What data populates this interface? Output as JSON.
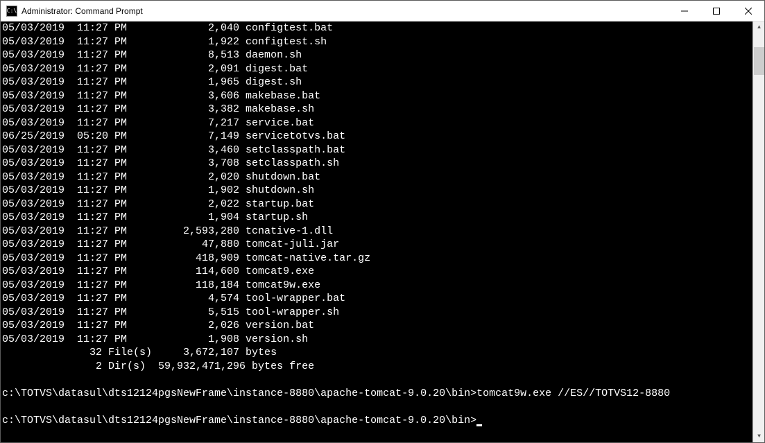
{
  "window": {
    "title": "Administrator: Command Prompt",
    "iconText": "C:\\"
  },
  "files": [
    {
      "date": "05/03/2019",
      "time": "11:27 PM",
      "size": "2,040",
      "name": "configtest.bat"
    },
    {
      "date": "05/03/2019",
      "time": "11:27 PM",
      "size": "1,922",
      "name": "configtest.sh"
    },
    {
      "date": "05/03/2019",
      "time": "11:27 PM",
      "size": "8,513",
      "name": "daemon.sh"
    },
    {
      "date": "05/03/2019",
      "time": "11:27 PM",
      "size": "2,091",
      "name": "digest.bat"
    },
    {
      "date": "05/03/2019",
      "time": "11:27 PM",
      "size": "1,965",
      "name": "digest.sh"
    },
    {
      "date": "05/03/2019",
      "time": "11:27 PM",
      "size": "3,606",
      "name": "makebase.bat"
    },
    {
      "date": "05/03/2019",
      "time": "11:27 PM",
      "size": "3,382",
      "name": "makebase.sh"
    },
    {
      "date": "05/03/2019",
      "time": "11:27 PM",
      "size": "7,217",
      "name": "service.bat"
    },
    {
      "date": "06/25/2019",
      "time": "05:20 PM",
      "size": "7,149",
      "name": "servicetotvs.bat"
    },
    {
      "date": "05/03/2019",
      "time": "11:27 PM",
      "size": "3,460",
      "name": "setclasspath.bat"
    },
    {
      "date": "05/03/2019",
      "time": "11:27 PM",
      "size": "3,708",
      "name": "setclasspath.sh"
    },
    {
      "date": "05/03/2019",
      "time": "11:27 PM",
      "size": "2,020",
      "name": "shutdown.bat"
    },
    {
      "date": "05/03/2019",
      "time": "11:27 PM",
      "size": "1,902",
      "name": "shutdown.sh"
    },
    {
      "date": "05/03/2019",
      "time": "11:27 PM",
      "size": "2,022",
      "name": "startup.bat"
    },
    {
      "date": "05/03/2019",
      "time": "11:27 PM",
      "size": "1,904",
      "name": "startup.sh"
    },
    {
      "date": "05/03/2019",
      "time": "11:27 PM",
      "size": "2,593,280",
      "name": "tcnative-1.dll"
    },
    {
      "date": "05/03/2019",
      "time": "11:27 PM",
      "size": "47,880",
      "name": "tomcat-juli.jar"
    },
    {
      "date": "05/03/2019",
      "time": "11:27 PM",
      "size": "418,909",
      "name": "tomcat-native.tar.gz"
    },
    {
      "date": "05/03/2019",
      "time": "11:27 PM",
      "size": "114,600",
      "name": "tomcat9.exe"
    },
    {
      "date": "05/03/2019",
      "time": "11:27 PM",
      "size": "118,184",
      "name": "tomcat9w.exe"
    },
    {
      "date": "05/03/2019",
      "time": "11:27 PM",
      "size": "4,574",
      "name": "tool-wrapper.bat"
    },
    {
      "date": "05/03/2019",
      "time": "11:27 PM",
      "size": "5,515",
      "name": "tool-wrapper.sh"
    },
    {
      "date": "05/03/2019",
      "time": "11:27 PM",
      "size": "2,026",
      "name": "version.bat"
    },
    {
      "date": "05/03/2019",
      "time": "11:27 PM",
      "size": "1,908",
      "name": "version.sh"
    }
  ],
  "summary": {
    "fileCount": "32",
    "fileLabel": "File(s)",
    "totalBytes": "3,672,107",
    "bytesLabel": "bytes",
    "dirCount": "2",
    "dirLabel": "Dir(s)",
    "freeBytes": "59,932,471,296",
    "freeLabel": "bytes free"
  },
  "prompts": [
    {
      "path": "c:\\TOTVS\\datasul\\dts12124pgsNewFrame\\instance-8880\\apache-tomcat-9.0.20\\bin>",
      "command": "tomcat9w.exe //ES//TOTVS12-8880"
    },
    {
      "path": "c:\\TOTVS\\datasul\\dts12124pgsNewFrame\\instance-8880\\apache-tomcat-9.0.20\\bin>",
      "command": ""
    }
  ]
}
